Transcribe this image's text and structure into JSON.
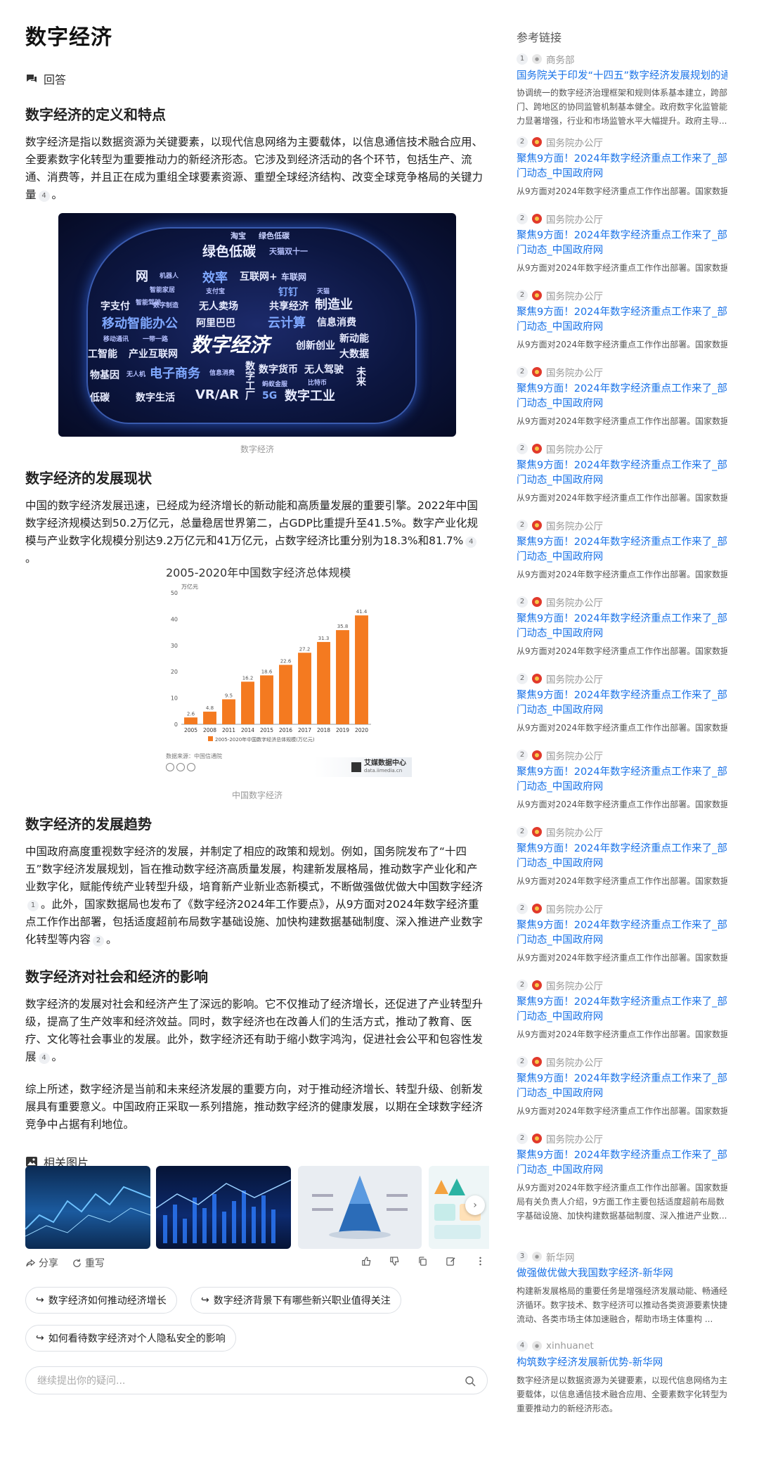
{
  "page": {
    "title": "数字经济",
    "answer_label": "回答"
  },
  "sections": [
    {
      "heading": "数字经济的定义和特点",
      "text": "数字经济是指以数据资源为关键要素，以现代信息网络为主要载体，以信息通信技术融合应用、全要素数字化转型为重要推动力的新经济形态。它涉及到经济活动的各个环节，包括生产、流通、消费等，并且正在成为重组全球要素资源、重塑全球经济结构、改变全球竞争格局的关键力量",
      "ref": "4"
    },
    {
      "heading": "数字经济的发展现状",
      "text": "中国的数字经济发展迅速，已经成为经济增长的新动能和高质量发展的重要引擎。2022年中国数字经济规模达到50.2万亿元，总量稳居世界第二，占GDP比重提升至41.5%。数字产业化规模与产业数字化规模分别达9.2万亿元和41万亿元，占数字经济比重分别为18.3%和81.7%",
      "ref": "4"
    },
    {
      "heading": "数字经济的发展趋势",
      "text_a": "中国政府高度重视数字经济的发展，并制定了相应的政策和规划。例如，国务院发布了“十四五”数字经济发展规划，旨在推动数字经济高质量发展，构建新发展格局，推动数字产业化和产业数字化，赋能传统产业转型升级，培育新产业新业态新模式，不断做强做优做大中国数字经济",
      "ref_a": "1",
      "text_b": "。此外，国家数据局也发布了《数字经济2024年工作要点》，从9方面对2024年数字经济重点工作作出部署，包括适度超前布局数字基础设施、加快构建数据基础制度、深入推进产业数字化转型等内容",
      "ref_b": "2"
    },
    {
      "heading": "数字经济对社会和经济的影响",
      "text": "数字经济的发展对社会和经济产生了深远的影响。它不仅推动了经济增长，还促进了产业转型升级，提高了生产效率和经济效益。同时，数字经济也在改善人们的生活方式，推动了教育、医疗、文化等社会事业的发展。此外，数字经济还有助于缩小数字鸿沟，促进社会公平和包容性发展",
      "ref": "4"
    }
  ],
  "conclusion": "综上所述，数字经济是当前和未来经济发展的重要方向，对于推动经济增长、转型升级、创新发展具有重要意义。中国政府正采取一系列措施，推动数字经济的健康发展，以期在全球数字经济竞争中占据有利地位。",
  "hero_image": {
    "caption": "数字经济",
    "words": [
      "淘宝",
      "绿色低碳",
      "绿色低碳",
      "天猫双十一",
      "网",
      "机器人",
      "效率",
      "互联网+",
      "车联网",
      "智能家居",
      "智能驾驶",
      "支付宝",
      "钉钉",
      "天猫",
      "字支付",
      "数字制造",
      "无人卖场",
      "共享经济",
      "制造业",
      "移动智能办公",
      "阿里巴巴",
      "云计算",
      "信息消费",
      "移动通讯",
      "一带一路",
      "数字经济",
      "创新创业",
      "新动能",
      "工智能",
      "产业互联网",
      "大数据",
      "物基因",
      "无人机",
      "电子商务",
      "信息消费",
      "数字货币",
      "无人驾驶",
      "未来",
      "低碳",
      "数字生活",
      "VR/AR",
      "5G",
      "数字工业",
      "数字工厂",
      "比特币",
      "蚂蚁金服"
    ]
  },
  "chart_data": {
    "type": "bar",
    "title": "2005-2020年中国数字经济总体规模",
    "ylabel": "万亿元",
    "categories": [
      "2005",
      "2008",
      "2011",
      "2014",
      "2015",
      "2016",
      "2017",
      "2018",
      "2019",
      "2020"
    ],
    "values": [
      2.6,
      4.8,
      9.5,
      16.2,
      18.6,
      22.6,
      27.2,
      31.3,
      35.8,
      41.4
    ],
    "value_labels": [
      "2.6",
      "4.8",
      "9.5",
      "16.2",
      "18.6",
      "22.6",
      "27.2",
      "31.3",
      "35.8",
      "41.4"
    ],
    "yticks": [
      "0",
      "10",
      "20",
      "30",
      "40",
      "50"
    ],
    "ylim": [
      0,
      50
    ],
    "legend": "2005-2020年中国数字经济总体规模(万亿元)",
    "source": "数据来源：中国信通院",
    "brand": "艾媒数据中心",
    "brand_sub": "data.iimedia.cn",
    "caption": "中国数字经济",
    "bar_color": "#f47a20"
  },
  "related_images": {
    "label": "相关图片"
  },
  "actions": {
    "share": "分享",
    "regenerate": "重写"
  },
  "suggestions": [
    "数字经济如何推动经济增长",
    "数字经济背景下有哪些新兴职业值得关注",
    "如何看待数字经济对个人隐私安全的影响"
  ],
  "ask": {
    "placeholder": "继续提出你的疑问..."
  },
  "references": {
    "title": "参考链接",
    "first": {
      "num": "1",
      "source": "商务部",
      "link": "国务院关于印发“十四五”数字经济发展规划的通知",
      "desc": "协调统一的数字经济治理框架和规则体系基本建立，跨部门、跨地区的协同监管机制基本健全。政府数字化监管能力显著增强，行业和市场监管水平大幅提升。政府主导..."
    },
    "repeat": {
      "num": "2",
      "source": "国务院办公厅",
      "link": "聚焦9方面！2024年数字经济重点工作来了_部门动态_中国政府网",
      "desc": "从9方面对2024年数字经济重点工作作出部署。国家数据"
    },
    "repeat_last_desc": "局有关负责人介绍，9方面工作主要包括适度超前布局数字基础设施、加快构建数据基础制度、深入推进产业数...",
    "third": {
      "num": "3",
      "source": "新华网",
      "link": "做强做优做大我国数字经济-新华网",
      "desc": "构建新发展格局的重要任务是增强经济发展动能、畅通经济循环。数字技术、数字经济可以推动各类资源要素快捷流动、各类市场主体加速融合，帮助市场主体重构 ..."
    },
    "fourth": {
      "num": "4",
      "source": "xinhuanet",
      "link": "构筑数字经济发展新优势-新华网",
      "desc": "数字经济是以数据资源为关键要素，以现代信息网络为主要载体，以信息通信技术融合应用、全要素数字化转型为重要推动力的新经济形态。"
    }
  }
}
